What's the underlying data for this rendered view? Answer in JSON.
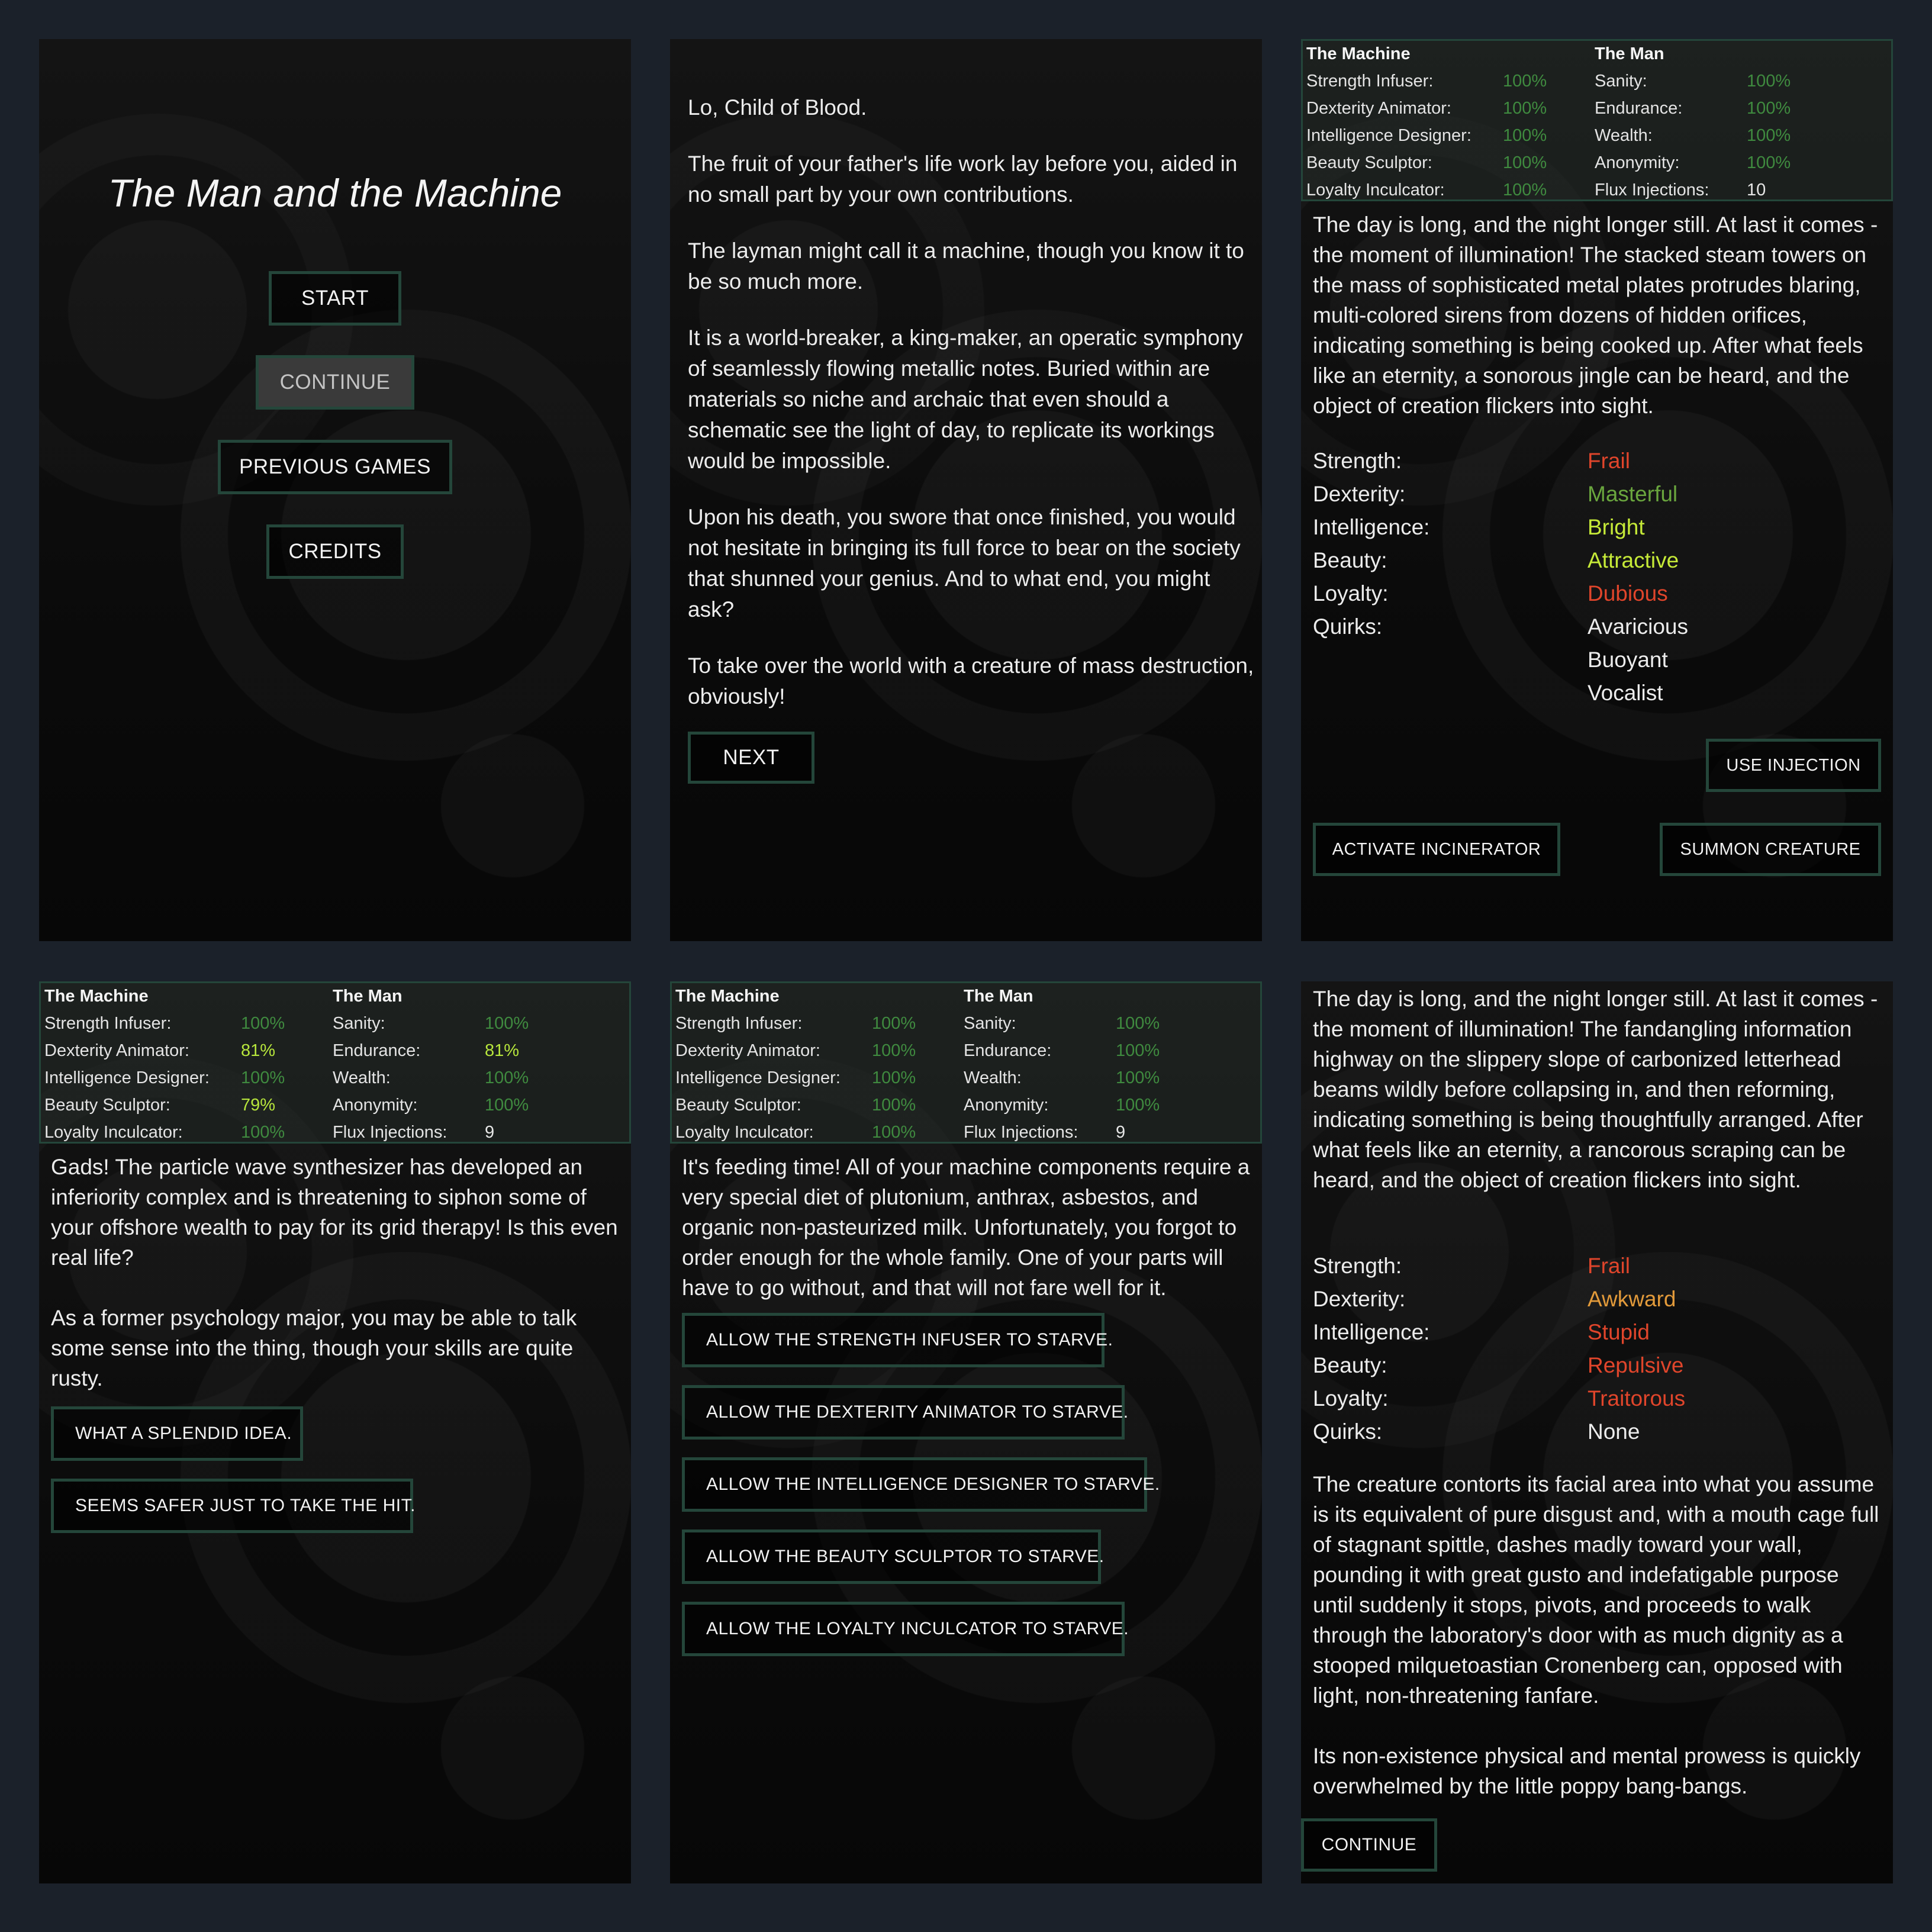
{
  "menu": {
    "title": "The Man and the Machine",
    "start": "START",
    "continue": "CONTINUE",
    "previous_games": "PREVIOUS GAMES",
    "credits": "CREDITS"
  },
  "intro": {
    "paragraphs": [
      "Lo, Child of Blood.",
      "The fruit of your father's life work lay before you, aided in no small part by your own contributions.",
      "The layman might call it a machine, though you know it to be so much more.",
      "It is a world-breaker, a king-maker, an operatic symphony of seamlessly flowing metallic notes. Buried within are materials so niche and archaic that even should a schematic see the light of day, to replicate its workings would be impossible.",
      "Upon his death, you swore that once finished, you would not hesitate in bringing its full force to bear on the society that shunned your genius. And to what end, you might ask?",
      "To take over the world with a creature of mass destruction, obviously!"
    ],
    "next": "NEXT"
  },
  "stat_labels": {
    "machine": "The Machine",
    "man": "The Man",
    "strength_infuser": "Strength Infuser:",
    "dexterity_animator": "Dexterity Animator:",
    "intelligence_designer": "Intelligence Designer:",
    "beauty_sculptor": "Beauty Sculptor:",
    "loyalty_inculcator": "Loyalty Inculcator:",
    "sanity": "Sanity:",
    "endurance": "Endurance:",
    "wealth": "Wealth:",
    "anonymity": "Anonymity:",
    "flux_injections": "Flux Injections:"
  },
  "attr_labels": {
    "strength": "Strength:",
    "dexterity": "Dexterity:",
    "intelligence": "Intelligence:",
    "beauty": "Beauty:",
    "loyalty": "Loyalty:",
    "quirks": "Quirks:"
  },
  "colors": {
    "full": "#3f8a3f",
    "damaged": "#b7e63c",
    "bad": "#e0452b",
    "masterful": "#6aa63e",
    "good": "#c6ea38",
    "awkward": "#e29a3a",
    "border": "#24463a"
  },
  "creation1": {
    "stats": {
      "strength_infuser": "100%",
      "dexterity_animator": "100%",
      "intelligence_designer": "100%",
      "beauty_sculptor": "100%",
      "loyalty_inculcator": "100%",
      "sanity": "100%",
      "endurance": "100%",
      "wealth": "100%",
      "anonymity": "100%",
      "flux_injections": "10"
    },
    "text": "The day is long, and the night longer still. At last it comes - the moment of illumination! The stacked steam towers on the mass of sophisticated metal plates protrudes blaring, multi-colored sirens from dozens of hidden orifices, indicating something is being cooked up. After what feels like an eternity, a sonorous jingle can be heard, and the object of creation flickers into sight.",
    "attrs": {
      "strength": "Frail",
      "dexterity": "Masterful",
      "intelligence": "Bright",
      "beauty": "Attractive",
      "loyalty": "Dubious",
      "quirks": [
        "Avaricious",
        "Buoyant",
        "Vocalist"
      ]
    },
    "use_injection": "USE INJECTION",
    "activate_incinerator": "ACTIVATE INCINERATOR",
    "summon_creature": "SUMMON CREATURE"
  },
  "event1": {
    "stats": {
      "strength_infuser": "100%",
      "dexterity_animator": "81%",
      "intelligence_designer": "100%",
      "beauty_sculptor": "79%",
      "loyalty_inculcator": "100%",
      "sanity": "100%",
      "endurance": "81%",
      "wealth": "100%",
      "anonymity": "100%",
      "flux_injections": "9"
    },
    "paragraphs": [
      "Gads! The particle wave synthesizer has developed an inferiority complex and is threatening to siphon some of your offshore wealth to pay for its grid therapy! Is this even real life?",
      "As a former psychology major, you may be able to talk some sense into the thing, though your skills are quite rusty."
    ],
    "options": [
      "WHAT A SPLENDID IDEA.",
      "SEEMS SAFER JUST TO TAKE THE HIT."
    ]
  },
  "event2": {
    "stats": {
      "strength_infuser": "100%",
      "dexterity_animator": "100%",
      "intelligence_designer": "100%",
      "beauty_sculptor": "100%",
      "loyalty_inculcator": "100%",
      "sanity": "100%",
      "endurance": "100%",
      "wealth": "100%",
      "anonymity": "100%",
      "flux_injections": "9"
    },
    "text": "It's feeding time! All of your machine components require a very special diet of plutonium, anthrax, asbestos, and organic non-pasteurized milk. Unfortunately, you forgot to order enough for the whole family. One of your parts will have to go without, and that will not fare well for it.",
    "options": [
      "ALLOW THE STRENGTH INFUSER TO STARVE.",
      "ALLOW THE DEXTERITY ANIMATOR TO STARVE.",
      "ALLOW THE INTELLIGENCE DESIGNER TO STARVE.",
      "ALLOW THE BEAUTY SCULPTOR TO STARVE.",
      "ALLOW THE LOYALTY INCULCATOR TO STARVE."
    ]
  },
  "creation2": {
    "text": "The day is long, and the night longer still. At last it comes - the moment of illumination! The fandangling information highway on the slippery slope of carbonized letterhead beams wildly before collapsing in, and then reforming, indicating something is being thoughtfully arranged. After what feels like an eternity, a rancorous scraping can be heard, and the object of creation flickers into sight.",
    "attrs": {
      "strength": "Frail",
      "dexterity": "Awkward",
      "intelligence": "Stupid",
      "beauty": "Repulsive",
      "loyalty": "Traitorous",
      "quirks": "None"
    },
    "outcome": [
      "The creature contorts its facial area into what you assume is its equivalent of pure disgust and, with a mouth cage full of stagnant spittle, dashes madly toward your wall, pounding it with great gusto and indefatigable purpose until suddenly it stops, pivots, and proceeds to walk through the laboratory's door with as much dignity as a stooped milquetoastian Cronenberg can, opposed with light, non-threatening fanfare.",
      "Its non-existence physical and mental prowess is quickly overwhelmed by the little poppy bang-bangs."
    ],
    "continue": "CONTINUE"
  }
}
